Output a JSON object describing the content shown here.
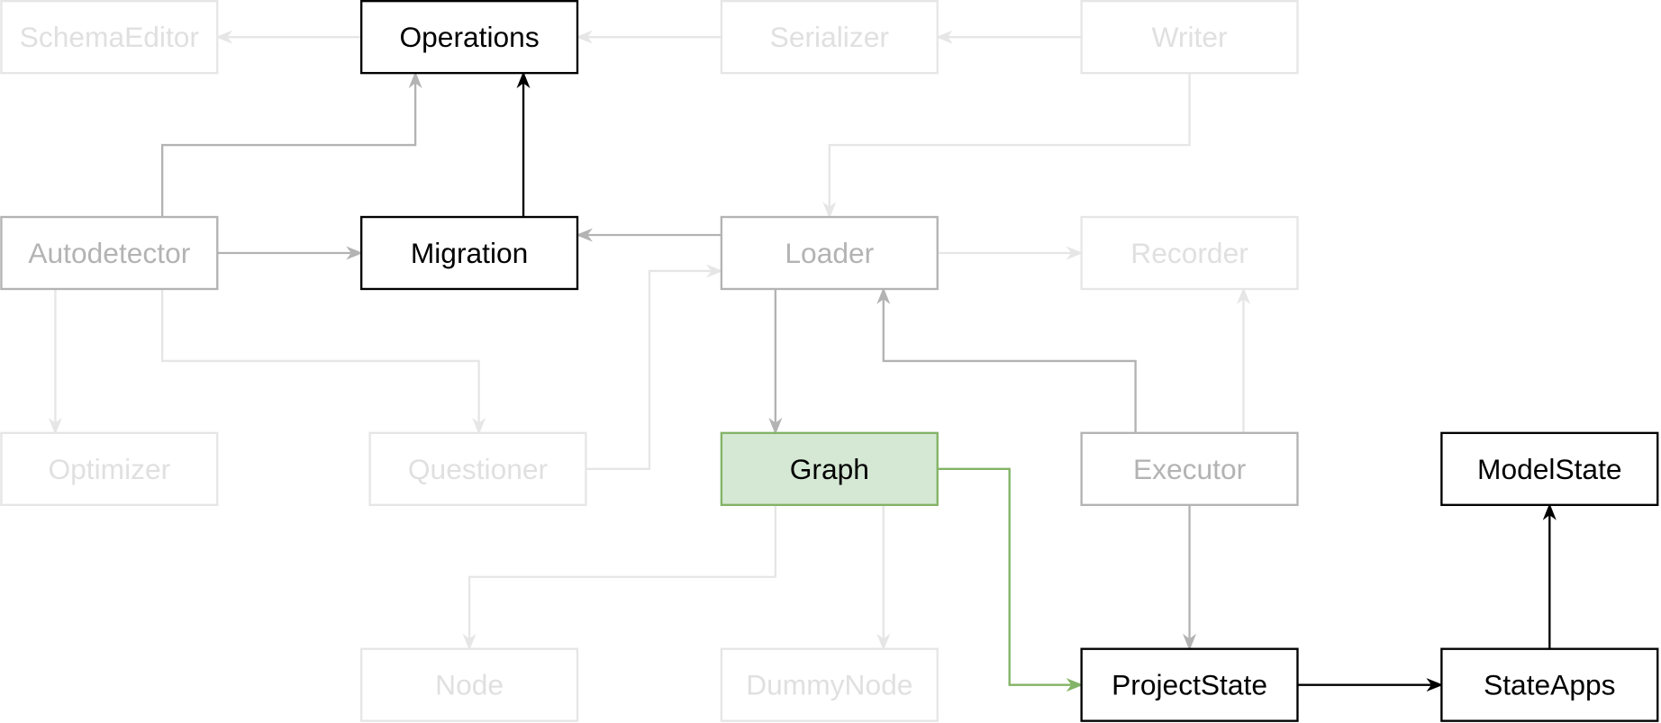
{
  "colors": {
    "light": "#e6e6e6",
    "mid": "#b3b3b3",
    "dark": "#000000",
    "green_stroke": "#82b366",
    "green_fill": "#d5e8d4"
  },
  "nodes": [
    {
      "id": "schemaeditor",
      "label": "SchemaEditor",
      "style": "light"
    },
    {
      "id": "operations",
      "label": "Operations",
      "style": "dark"
    },
    {
      "id": "serializer",
      "label": "Serializer",
      "style": "light"
    },
    {
      "id": "writer",
      "label": "Writer",
      "style": "light"
    },
    {
      "id": "autodetector",
      "label": "Autodetector",
      "style": "mid"
    },
    {
      "id": "migration",
      "label": "Migration",
      "style": "dark"
    },
    {
      "id": "loader",
      "label": "Loader",
      "style": "mid"
    },
    {
      "id": "recorder",
      "label": "Recorder",
      "style": "light"
    },
    {
      "id": "optimizer",
      "label": "Optimizer",
      "style": "light"
    },
    {
      "id": "questioner",
      "label": "Questioner",
      "style": "light"
    },
    {
      "id": "graph",
      "label": "Graph",
      "style": "green"
    },
    {
      "id": "executor",
      "label": "Executor",
      "style": "mid"
    },
    {
      "id": "modelstate",
      "label": "ModelState",
      "style": "dark"
    },
    {
      "id": "node",
      "label": "Node",
      "style": "light"
    },
    {
      "id": "dummynode",
      "label": "DummyNode",
      "style": "light"
    },
    {
      "id": "projectstate",
      "label": "ProjectState",
      "style": "dark"
    },
    {
      "id": "stateapps",
      "label": "StateApps",
      "style": "dark"
    }
  ],
  "edges": [
    {
      "from": "operations",
      "to": "schemaeditor",
      "style": "light"
    },
    {
      "from": "serializer",
      "to": "operations",
      "style": "light"
    },
    {
      "from": "writer",
      "to": "serializer",
      "style": "light"
    },
    {
      "from": "writer",
      "to": "loader",
      "style": "light"
    },
    {
      "from": "autodetector",
      "to": "operations",
      "style": "mid"
    },
    {
      "from": "migration",
      "to": "operations",
      "style": "dark"
    },
    {
      "from": "autodetector",
      "to": "migration",
      "style": "mid"
    },
    {
      "from": "loader",
      "to": "migration",
      "style": "mid"
    },
    {
      "from": "loader",
      "to": "recorder",
      "style": "light"
    },
    {
      "from": "questioner",
      "to": "loader",
      "style": "light"
    },
    {
      "from": "autodetector",
      "to": "optimizer",
      "style": "light"
    },
    {
      "from": "autodetector",
      "to": "questioner",
      "style": "light"
    },
    {
      "from": "loader",
      "to": "graph",
      "style": "mid"
    },
    {
      "from": "executor",
      "to": "loader",
      "style": "mid"
    },
    {
      "from": "executor",
      "to": "recorder",
      "style": "light"
    },
    {
      "from": "graph",
      "to": "projectstate",
      "style": "green"
    },
    {
      "from": "executor",
      "to": "projectstate",
      "style": "mid"
    },
    {
      "from": "graph",
      "to": "node",
      "style": "light"
    },
    {
      "from": "graph",
      "to": "dummynode",
      "style": "light"
    },
    {
      "from": "projectstate",
      "to": "stateapps",
      "style": "dark"
    },
    {
      "from": "stateapps",
      "to": "modelstate",
      "style": "dark"
    }
  ]
}
